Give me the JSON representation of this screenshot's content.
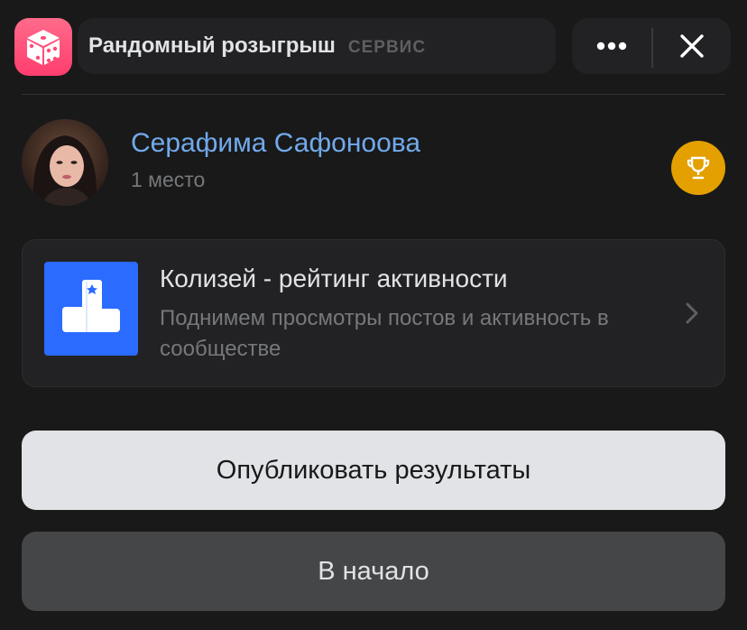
{
  "header": {
    "app_title": "Рандомный розыгрыш",
    "app_subtitle": "СЕРВИС",
    "app_icon": "dice-icon",
    "more_icon": "more-horizontal-icon",
    "close_icon": "close-icon"
  },
  "winner": {
    "name": "Серафима Сафоноова",
    "place": "1 место",
    "badge_icon": "trophy-icon",
    "badge_color": "#e3a000"
  },
  "promo": {
    "title": "Колизей - рейтинг активности",
    "description": "Поднимем просмотры постов и активность в сообществе",
    "icon": "podium-icon",
    "icon_color": "#2b6bff"
  },
  "actions": {
    "publish_label": "Опубликовать результаты",
    "home_label": "В начало"
  },
  "colors": {
    "background": "#19191a",
    "accent_link": "#71aaeb",
    "app_icon": "#ff4f7a"
  }
}
